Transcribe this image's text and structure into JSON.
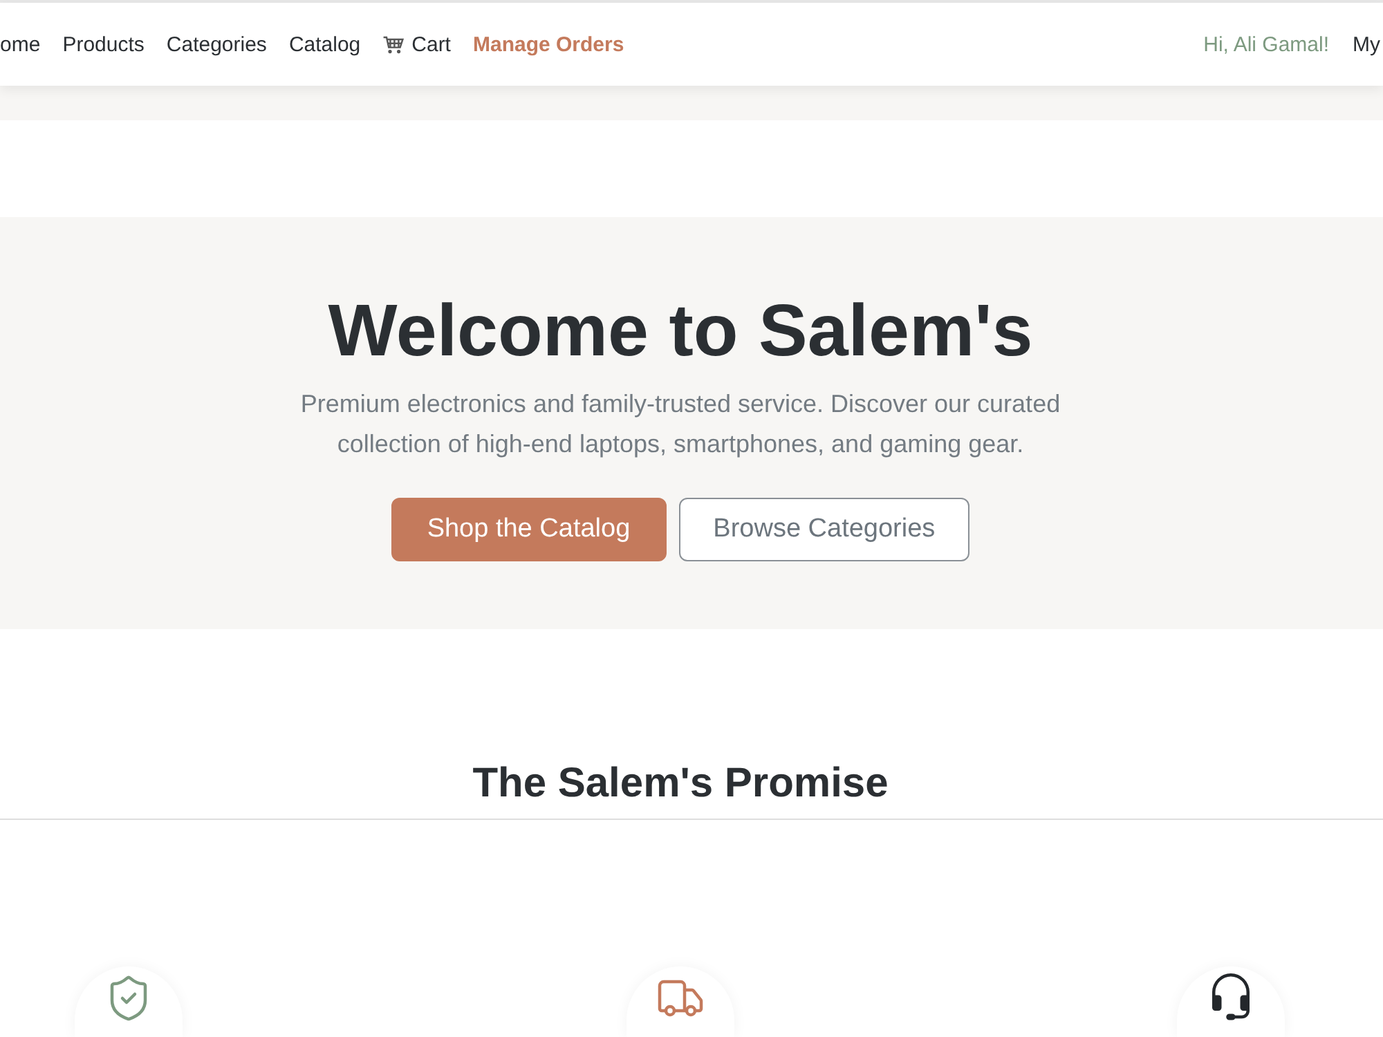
{
  "navbar": {
    "links": [
      {
        "kind": "link",
        "label": "ome"
      },
      {
        "kind": "link",
        "label": "Products"
      },
      {
        "kind": "link",
        "label": "Categories"
      },
      {
        "kind": "link",
        "label": "Catalog"
      },
      {
        "kind": "cart",
        "label": "Cart"
      },
      {
        "kind": "accent",
        "label": "Manage Orders"
      }
    ],
    "greeting": "Hi, Ali Gamal!",
    "account_link": "My"
  },
  "hero": {
    "title": "Welcome to Salem's",
    "subtitle": "Premium electronics and family-trusted service. Discover our curated collection of high-end laptops, smartphones, and gaming gear.",
    "buttons": [
      {
        "kind": "primary",
        "label": "Shop the Catalog"
      },
      {
        "kind": "outline",
        "label": "Browse Categories"
      }
    ]
  },
  "promise": {
    "heading": "The Salem's Promise",
    "features": [
      {
        "kind": "shield"
      },
      {
        "kind": "truck"
      },
      {
        "kind": "headset"
      }
    ]
  }
}
